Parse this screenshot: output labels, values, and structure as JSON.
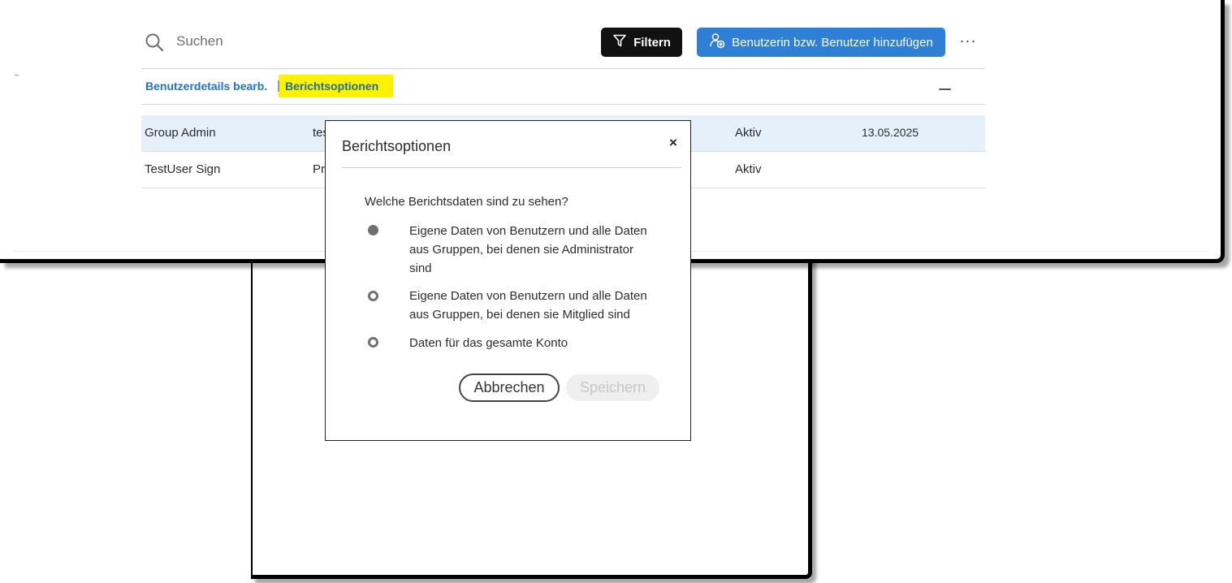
{
  "toolbar": {
    "search_placeholder": "Suchen",
    "filter_label": "Filtern",
    "add_user_label": "Benutzerin bzw. Benutzer hinzufügen",
    "more_label": "···"
  },
  "header": {
    "edit_details_link": "Benutzerdetails bearb.",
    "separator": "|",
    "report_options_link": "Berichtsoptionen"
  },
  "rows": [
    {
      "name": "Group Admin",
      "email": "tes",
      "status": "Aktiv",
      "date": "13.05.2025",
      "selected": true
    },
    {
      "name": "TestUser Sign",
      "email": "Pr",
      "status": "Aktiv",
      "date": "",
      "selected": false
    }
  ],
  "dialog": {
    "title": "Berichtsoptionen",
    "close_label": "×",
    "question": "Welche Berichtsdaten sind zu sehen?",
    "options": [
      {
        "label": "Eigene Daten von Benutzern und alle Daten aus Gruppen, bei denen sie Administrator sind",
        "selected": true
      },
      {
        "label": "Eigene Daten von Benutzern und alle Daten aus Gruppen, bei denen sie Mitglied sind",
        "selected": false
      },
      {
        "label": "Daten für das gesamte Konto",
        "selected": false
      }
    ],
    "cancel_label": "Abbrechen",
    "save_label": "Speichern"
  },
  "colors": {
    "primary_blue": "#2f7fd6",
    "link_blue": "#1f73c8",
    "highlight_yellow": "#fff200",
    "selected_row": "#e5f0fa"
  }
}
